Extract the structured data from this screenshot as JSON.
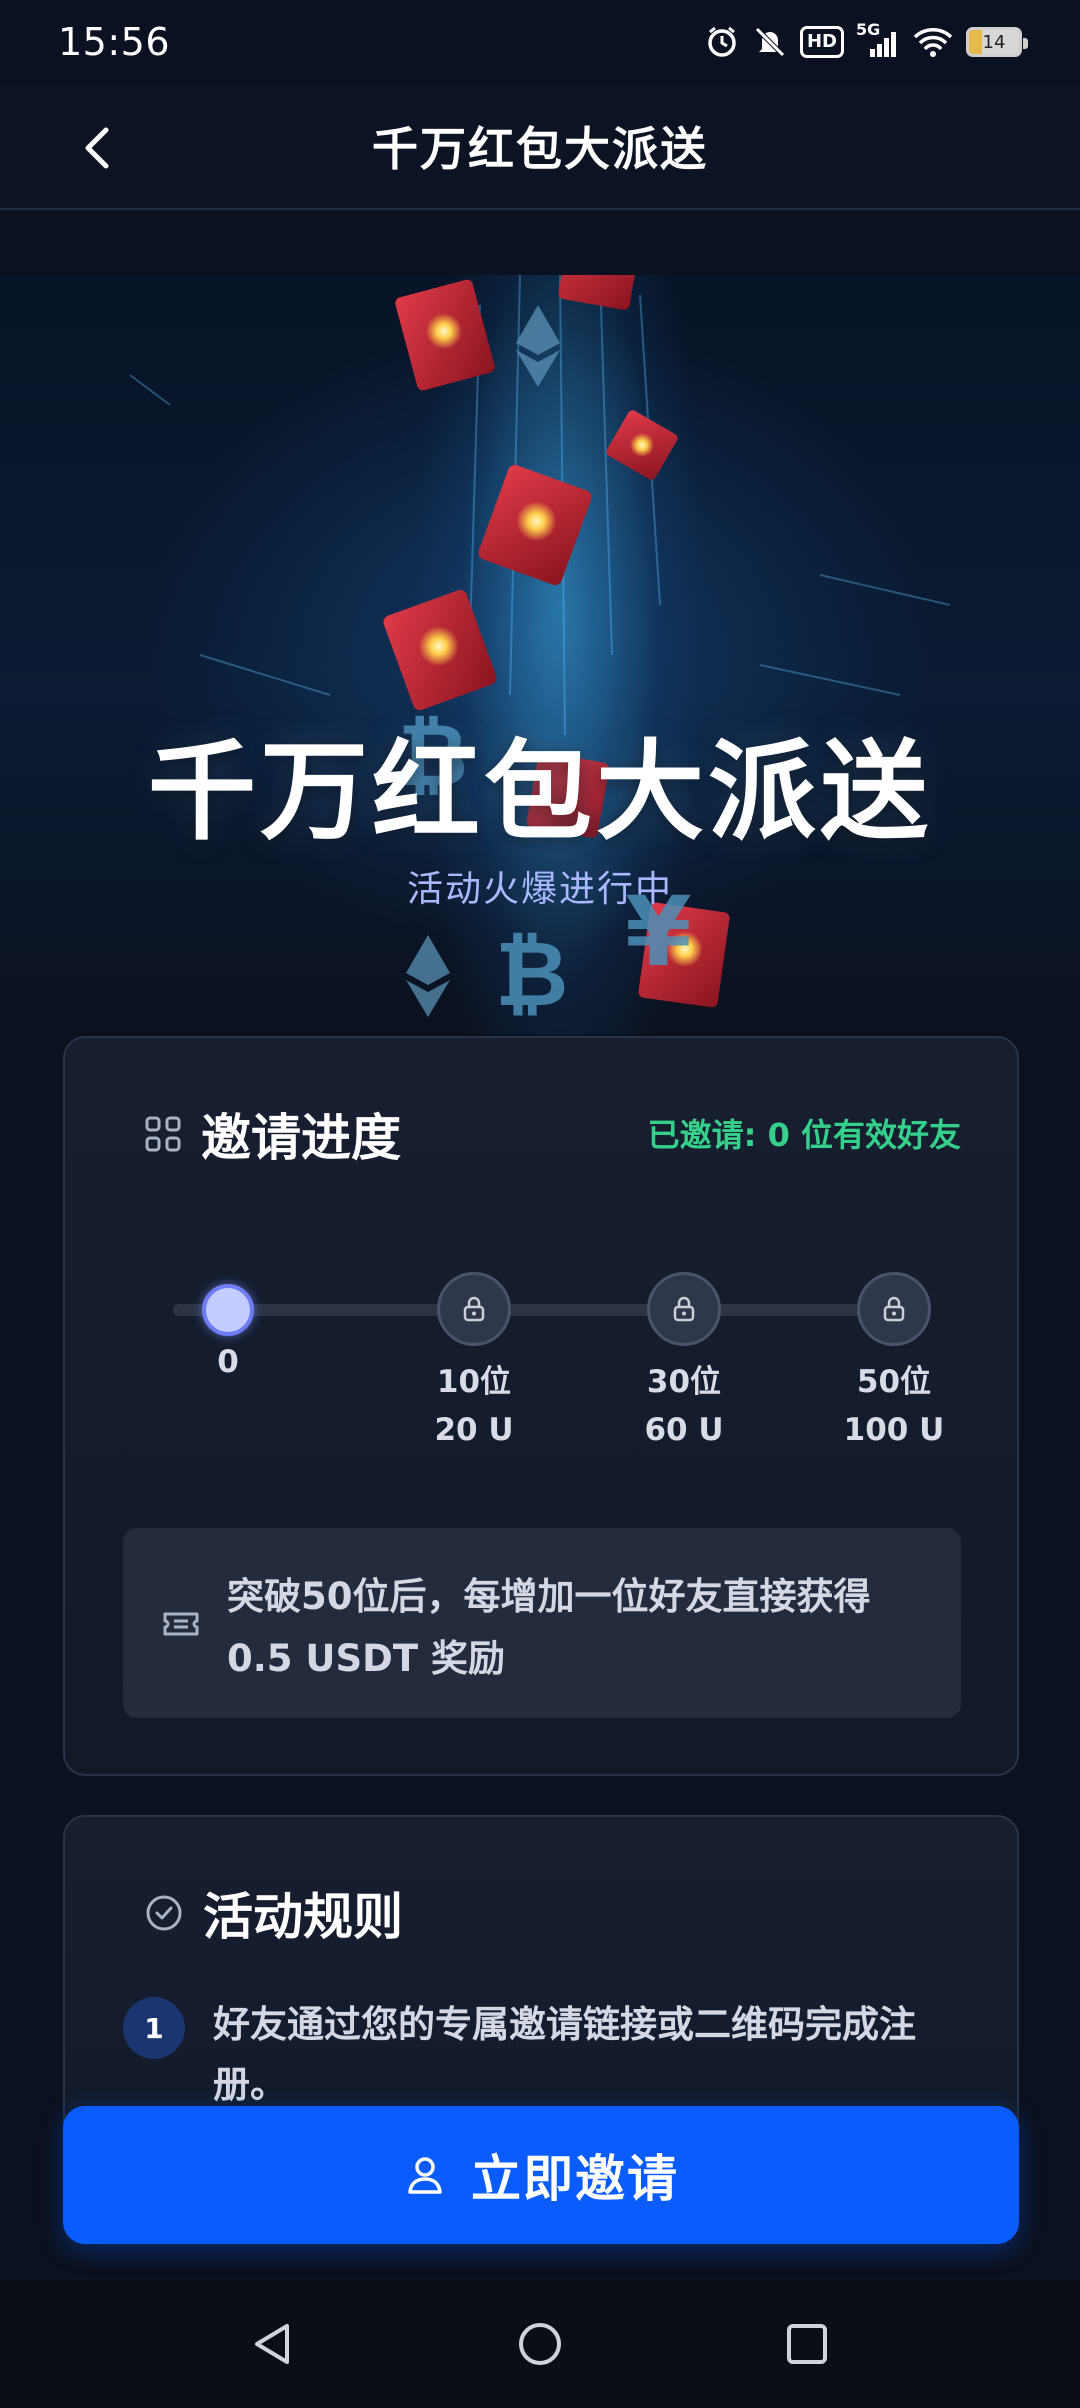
{
  "status_bar": {
    "time": "15:56",
    "hd_label": "HD",
    "signal_label": "5G",
    "battery_level": "14"
  },
  "header": {
    "title": "千万红包大派送"
  },
  "hero": {
    "title": "千万红包大派送",
    "subtitle": "活动火爆进行中"
  },
  "progress_card": {
    "title": "邀请进度",
    "invited_text": "已邀请: 0 位有效好友",
    "milestones": [
      {
        "label_line1": "0",
        "label_line2": "",
        "locked": false,
        "current": true
      },
      {
        "label_line1": "10位",
        "label_line2": "20 U",
        "locked": true,
        "current": false
      },
      {
        "label_line1": "30位",
        "label_line2": "60 U",
        "locked": true,
        "current": false
      },
      {
        "label_line1": "50位",
        "label_line2": "100 U",
        "locked": true,
        "current": false
      }
    ],
    "bonus_text": "突破50位后，每增加一位好友直接获得 0.5 USDT 奖励"
  },
  "rules_card": {
    "title": "活动规则",
    "items": [
      {
        "number": "1",
        "text": "好友通过您的专属邀请链接或二维码完成注册。"
      }
    ]
  },
  "invite_button": {
    "label": "立即邀请"
  },
  "colors": {
    "accent_blue": "#0a5cff",
    "invited_green": "#35d18a",
    "background": "#0b1120",
    "card": "#161e30"
  },
  "icons": {
    "back": "chevron-left-icon",
    "grid": "grid-icon",
    "ticket": "ticket-icon",
    "check": "check-circle-icon",
    "user": "user-icon",
    "lock": "lock-icon"
  }
}
